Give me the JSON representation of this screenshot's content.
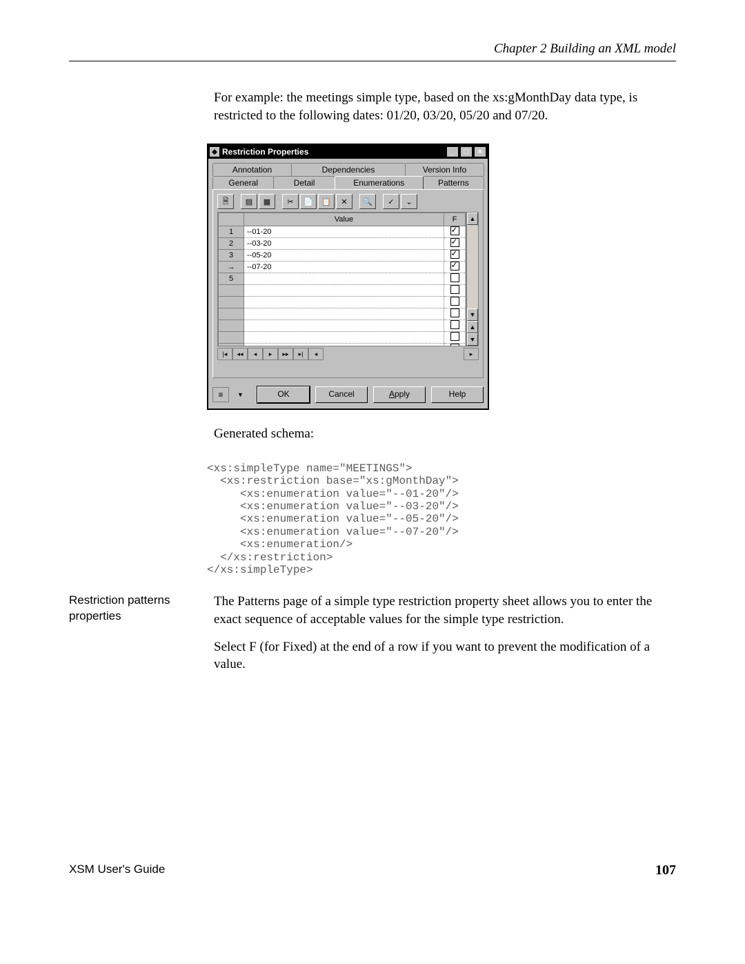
{
  "header": {
    "chapter": "Chapter 2  Building an XML model"
  },
  "intro": "For example: the meetings simple type, based on the xs:gMonthDay data type, is restricted to the following dates: 01/20, 03/20, 05/20 and 07/20.",
  "dialog": {
    "title": "Restriction Properties",
    "win_minimize": "_",
    "win_maximize": "□",
    "win_close": "×",
    "tabs_back": [
      "Annotation",
      "Dependencies",
      "Version Info"
    ],
    "tabs_front": [
      "General",
      "Detail",
      "Enumerations",
      "Patterns"
    ],
    "columns": {
      "value": "Value",
      "f": "F"
    },
    "rows": [
      {
        "n": "1",
        "value": "--01-20",
        "f": true
      },
      {
        "n": "2",
        "value": "--03-20",
        "f": true
      },
      {
        "n": "3",
        "value": "--05-20",
        "f": true
      },
      {
        "n": "→",
        "value": "--07-20",
        "f": true
      },
      {
        "n": "5",
        "value": "",
        "f": false
      }
    ],
    "buttons": {
      "ok": "OK",
      "cancel": "Cancel",
      "apply": "Apply",
      "help": "Help"
    }
  },
  "generated_label": "Generated schema:",
  "code": "<xs:simpleType name=\"MEETINGS\">\n  <xs:restriction base=\"xs:gMonthDay\">\n     <xs:enumeration value=\"--01-20\"/>\n     <xs:enumeration value=\"--03-20\"/>\n     <xs:enumeration value=\"--05-20\"/>\n     <xs:enumeration value=\"--07-20\"/>\n     <xs:enumeration/>\n  </xs:restriction>\n</xs:simpleType>",
  "section_label": "Restriction patterns properties",
  "para1": "The Patterns page of a simple type restriction property sheet allows you to enter the exact sequence of acceptable values for the simple type restriction.",
  "para2": "Select F (for Fixed) at the end of a row if you want to prevent the modification of a value.",
  "footer": {
    "guide": "XSM User's Guide",
    "page": "107"
  }
}
